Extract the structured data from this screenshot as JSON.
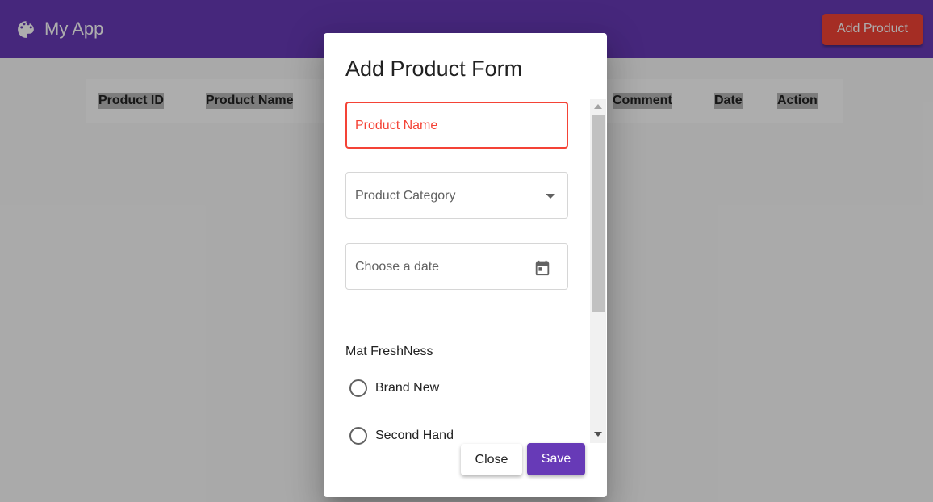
{
  "toolbar": {
    "app_title": "My App",
    "logo_icon": "palette-icon",
    "add_button_label": "Add Product",
    "color": "#673ab7",
    "add_button_color": "#f44336"
  },
  "table": {
    "columns": [
      "Product ID",
      "Product Name",
      "Comment",
      "Date",
      "Action"
    ]
  },
  "dialog": {
    "title": "Add Product Form",
    "product_name_label": "Product Name",
    "product_category_label": "Product Category",
    "date_label": "Choose a date",
    "date_icon": "calendar-icon",
    "freshness_label": "Mat FreshNess",
    "freshness_options": [
      "Brand New",
      "Second Hand"
    ],
    "close_label": "Close",
    "save_label": "Save",
    "error_color": "#f44336"
  }
}
